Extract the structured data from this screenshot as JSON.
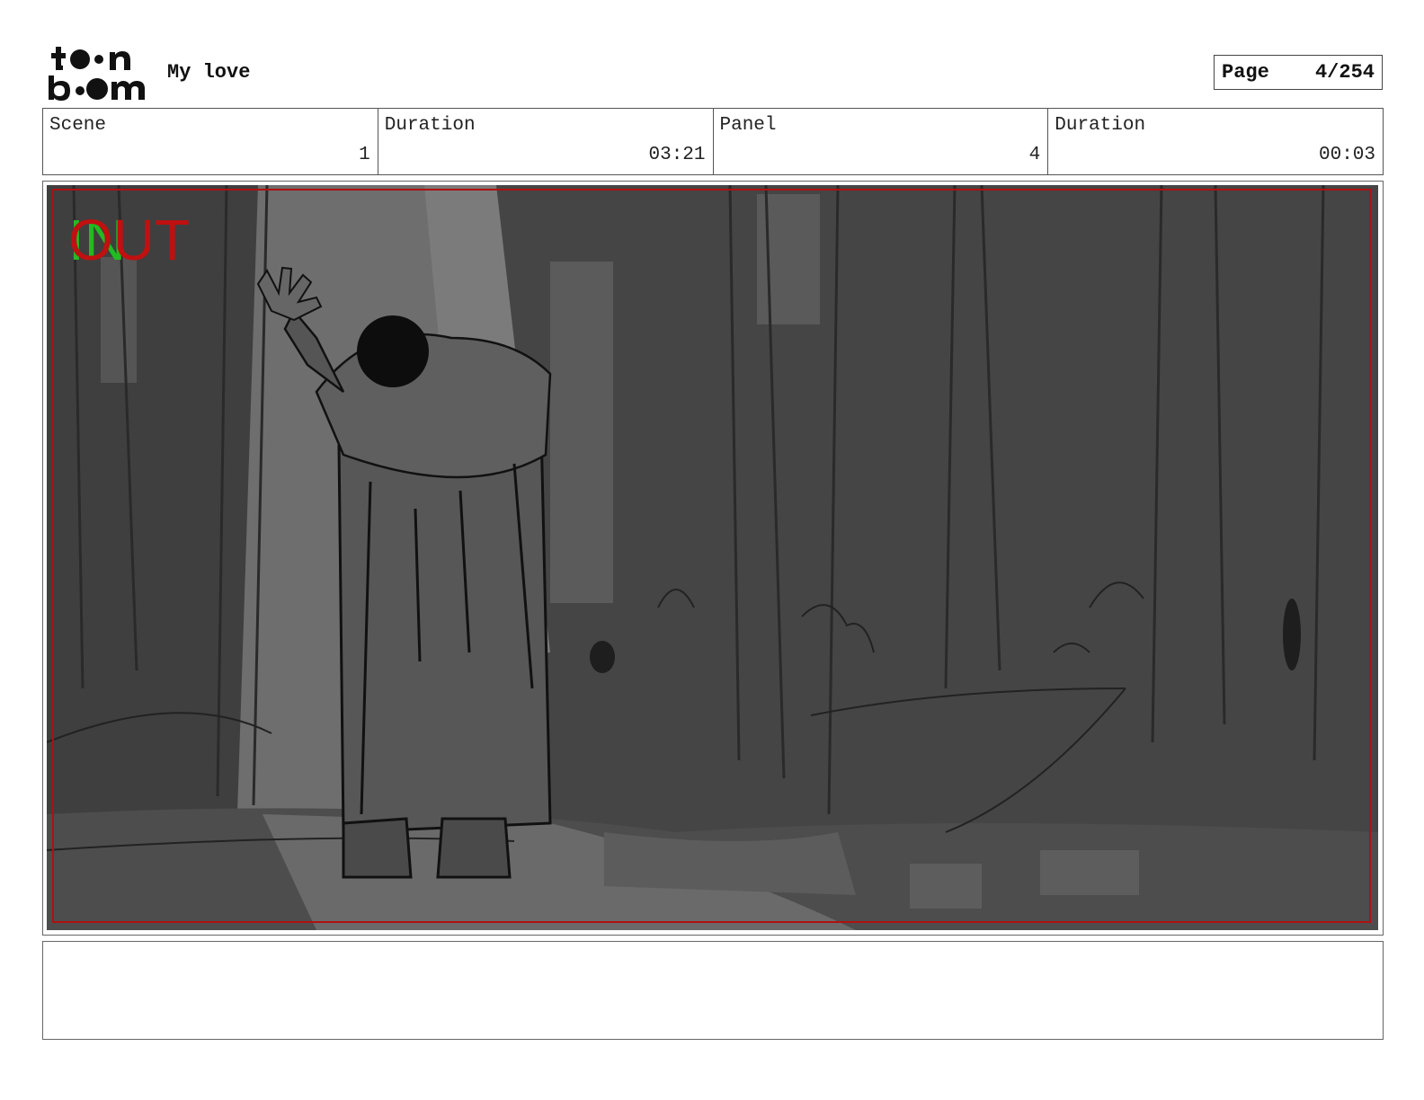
{
  "header": {
    "logo_name": "toonboom-logo",
    "project_title": "My love",
    "page_label": "Page",
    "page_value": "4/254"
  },
  "info": {
    "scene_label": "Scene",
    "scene_value": "1",
    "scene_duration_label": "Duration",
    "scene_duration_value": "03:21",
    "panel_label": "Panel",
    "panel_value": "4",
    "panel_duration_label": "Duration",
    "panel_duration_value": "00:03"
  },
  "panel": {
    "overlay_in": "IN",
    "overlay_out": "OUT",
    "colors": {
      "safe_frame": "#b01010",
      "in_marker": "#22bb22",
      "out_marker": "#c01010",
      "background": "#454545"
    }
  },
  "notes": {
    "text": ""
  }
}
